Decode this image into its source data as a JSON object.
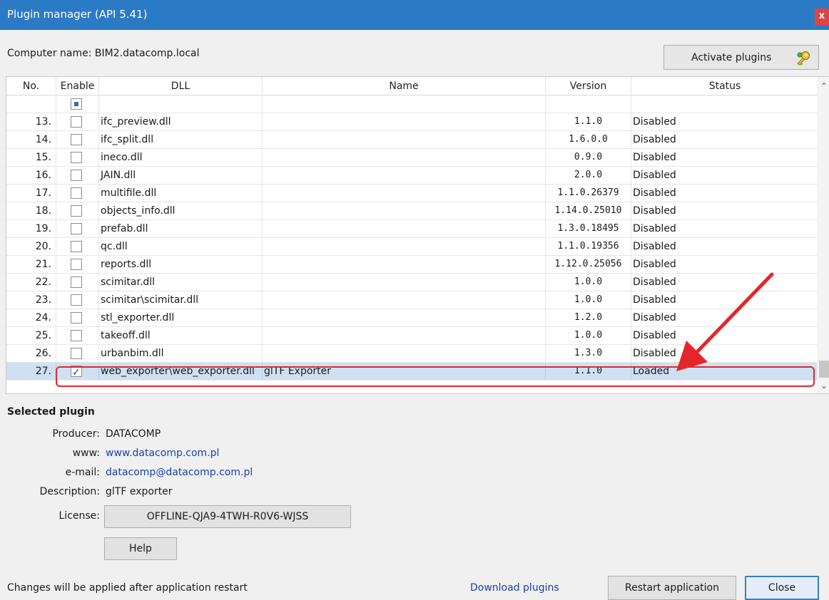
{
  "window": {
    "title": "Plugin manager (API 5.41)",
    "close_label": "x"
  },
  "computer_name": "Computer name: BIM2.datacomp.local",
  "activate_label": "Activate plugins",
  "columns": {
    "no": "No.",
    "enable": "Enable",
    "dll": "DLL",
    "name": "Name",
    "version": "Version",
    "status": "Status"
  },
  "rows": [
    {
      "no": "13.",
      "enabled": false,
      "dll": "ifc_preview.dll",
      "name": "",
      "version": "1.1.0",
      "status": "Disabled"
    },
    {
      "no": "14.",
      "enabled": false,
      "dll": "ifc_split.dll",
      "name": "",
      "version": "1.6.0.0",
      "status": "Disabled"
    },
    {
      "no": "15.",
      "enabled": false,
      "dll": "ineco.dll",
      "name": "",
      "version": "0.9.0",
      "status": "Disabled"
    },
    {
      "no": "16.",
      "enabled": false,
      "dll": "JAIN.dll",
      "name": "",
      "version": "2.0.0",
      "status": "Disabled"
    },
    {
      "no": "17.",
      "enabled": false,
      "dll": "multifile.dll",
      "name": "",
      "version": "1.1.0.26379",
      "status": "Disabled"
    },
    {
      "no": "18.",
      "enabled": false,
      "dll": "objects_info.dll",
      "name": "",
      "version": "1.14.0.25010",
      "status": "Disabled"
    },
    {
      "no": "19.",
      "enabled": false,
      "dll": "prefab.dll",
      "name": "",
      "version": "1.3.0.18495",
      "status": "Disabled"
    },
    {
      "no": "20.",
      "enabled": false,
      "dll": "qc.dll",
      "name": "",
      "version": "1.1.0.19356",
      "status": "Disabled"
    },
    {
      "no": "21.",
      "enabled": false,
      "dll": "reports.dll",
      "name": "",
      "version": "1.12.0.25056",
      "status": "Disabled"
    },
    {
      "no": "22.",
      "enabled": false,
      "dll": "scimitar.dll",
      "name": "",
      "version": "1.0.0",
      "status": "Disabled"
    },
    {
      "no": "23.",
      "enabled": false,
      "dll": "scimitar\\scimitar.dll",
      "name": "",
      "version": "1.0.0",
      "status": "Disabled"
    },
    {
      "no": "24.",
      "enabled": false,
      "dll": "stl_exporter.dll",
      "name": "",
      "version": "1.2.0",
      "status": "Disabled"
    },
    {
      "no": "25.",
      "enabled": false,
      "dll": "takeoff.dll",
      "name": "",
      "version": "1.0.0",
      "status": "Disabled"
    },
    {
      "no": "26.",
      "enabled": false,
      "dll": "urbanbim.dll",
      "name": "",
      "version": "1.3.0",
      "status": "Disabled"
    },
    {
      "no": "27.",
      "enabled": true,
      "selected": true,
      "dll": "web_exporter\\web_exporter.dll",
      "name": "glTF Exporter",
      "version": "1.1.0",
      "status": "Loaded"
    }
  ],
  "selected_plugin": {
    "heading": "Selected plugin",
    "producer_label": "Producer:",
    "producer": "DATACOMP",
    "www_label": "www:",
    "www": "www.datacomp.com.pl",
    "email_label": "e-mail:",
    "email": "datacomp@datacomp.com.pl",
    "description_label": "Description:",
    "description": "glTF exporter",
    "license_label": "License:",
    "license": "OFFLINE-QJA9-4TWH-R0V6-WJSS",
    "help_label": "Help"
  },
  "footer": {
    "note": "Changes will be applied after application restart",
    "download_label": "Download plugins",
    "restart_label": "Restart application",
    "close_label": "Close"
  },
  "colors": {
    "titlebar": "#2b7ac6",
    "selection": "#cfe0f3",
    "highlight": "#e3262b",
    "link": "#1a3fb0"
  }
}
